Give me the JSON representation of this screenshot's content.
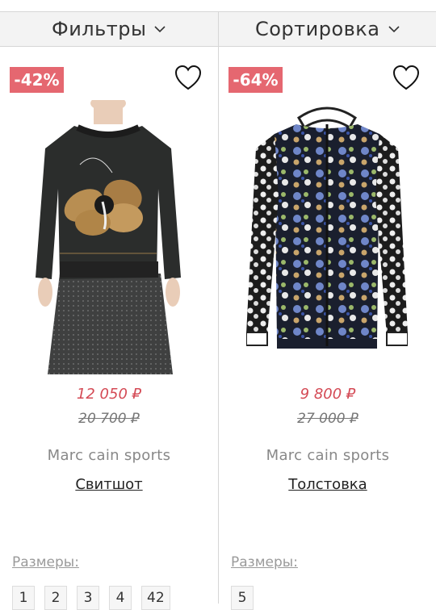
{
  "header": {
    "filters_label": "Фильтры",
    "sort_label": "Сортировка"
  },
  "products": [
    {
      "discount": "-42%",
      "price": "12 050 ₽",
      "old_price": "20 700 ₽",
      "brand": "Marc cain sports",
      "name": "Свитшот",
      "sizes_label": "Размеры:",
      "sizes": [
        "1",
        "2",
        "3",
        "4",
        "42"
      ],
      "accent": "#e56770"
    },
    {
      "discount": "-64%",
      "price": "9 800 ₽",
      "old_price": "27 000 ₽",
      "brand": "Marc cain sports",
      "name": "Толстовка",
      "sizes_label": "Размеры:",
      "sizes": [
        "5"
      ],
      "accent": "#e56770"
    }
  ],
  "icons": {
    "dropdown": "chevron-down-icon",
    "favorite": "heart-icon"
  }
}
